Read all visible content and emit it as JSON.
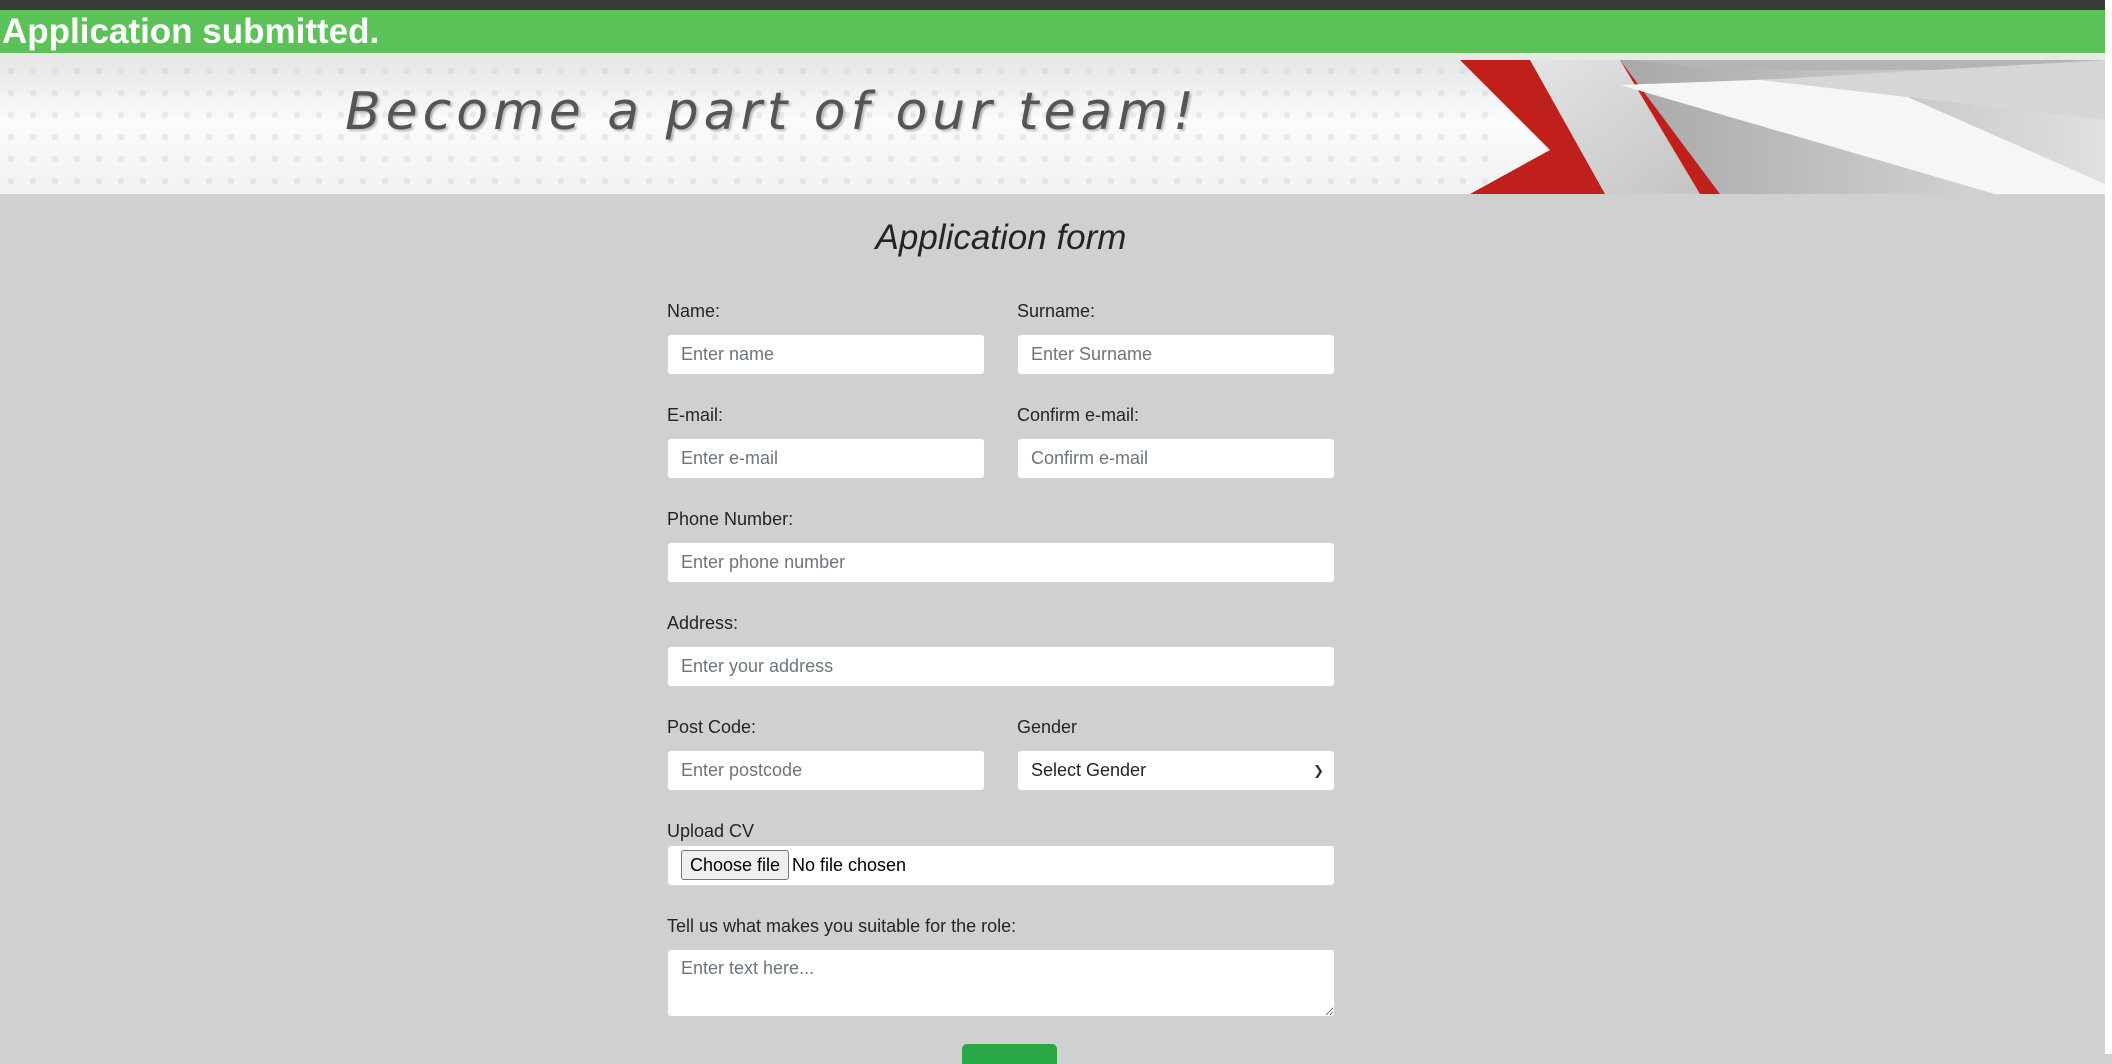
{
  "alert": {
    "message": "Application submitted."
  },
  "banner": {
    "tagline": "Become a part of our team!"
  },
  "form": {
    "title": "Application form",
    "name": {
      "label": "Name:",
      "placeholder": "Enter name"
    },
    "surname": {
      "label": "Surname:",
      "placeholder": "Enter Surname"
    },
    "email": {
      "label": "E-mail:",
      "placeholder": "Enter e-mail"
    },
    "confirm_email": {
      "label": "Confirm e-mail:",
      "placeholder": "Confirm e-mail"
    },
    "phone": {
      "label": "Phone Number:",
      "placeholder": "Enter phone number"
    },
    "address": {
      "label": "Address:",
      "placeholder": "Enter your address"
    },
    "postcode": {
      "label": "Post Code:",
      "placeholder": "Enter postcode"
    },
    "gender": {
      "label": "Gender",
      "selected": "Select Gender",
      "icon": "chevron-down-icon"
    },
    "cv": {
      "label": "Upload CV",
      "button": "Choose file",
      "status": "No file chosen"
    },
    "suitability": {
      "label": "Tell us what makes you suitable for the role:",
      "placeholder": "Enter text here..."
    }
  },
  "colors": {
    "success": "#5cc158",
    "page_background": "#d0d0d0",
    "banner_red": "#c0201b",
    "submit_button": "#28a745"
  }
}
